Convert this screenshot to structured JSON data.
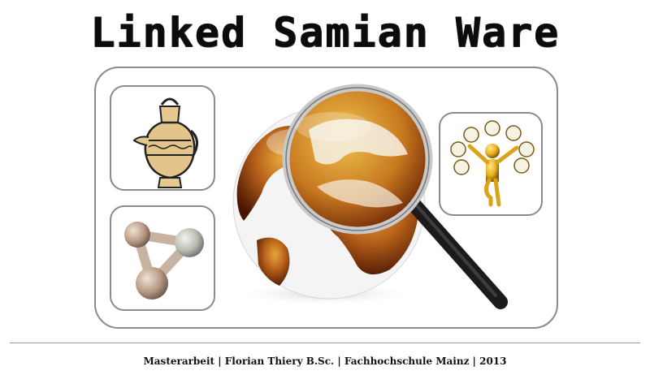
{
  "header": {
    "title": "Linked Samian Ware"
  },
  "illustrations": {
    "vessel": "amphora-vessel-icon",
    "network": "molecule-network-icon",
    "globe": "globe-with-magnifier-icon",
    "clocks": "clock-juggler-icon"
  },
  "footer": {
    "credit": "Masterarbeit | Florian Thiery B.Sc. | Fachhochschule Mainz | 2013"
  },
  "colors": {
    "frame": "#8a8a8a",
    "globe_warm": "#b8611a",
    "globe_dark": "#5a1e05",
    "gold": "#e8b31f"
  }
}
